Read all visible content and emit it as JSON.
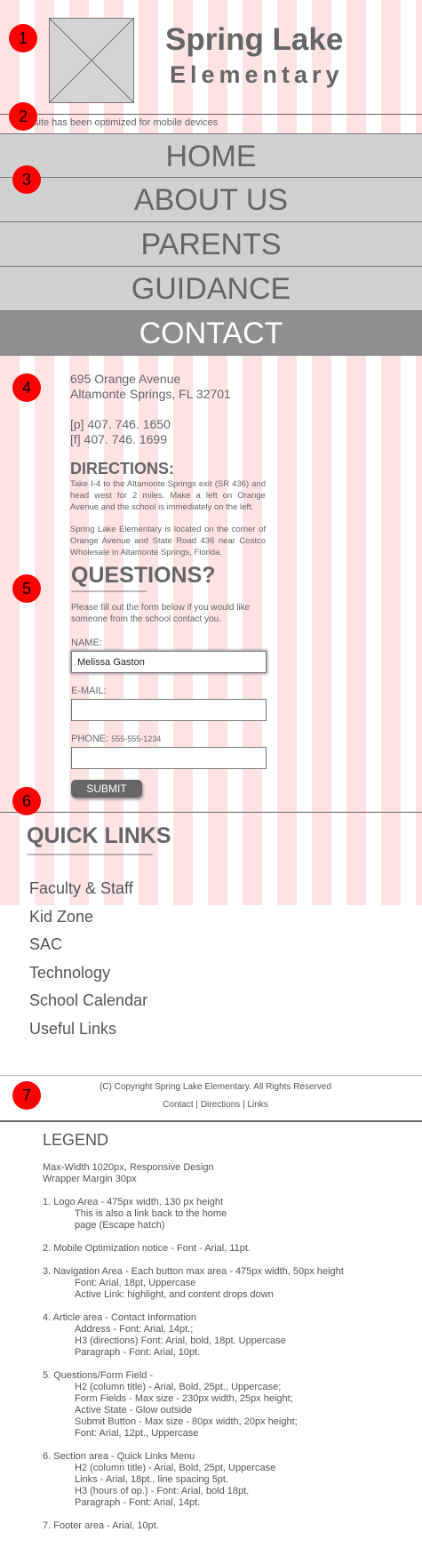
{
  "header": {
    "title_line1": "Spring Lake",
    "title_line2": "Elementary",
    "mobile_notice": "site has been optimized for mobile devices"
  },
  "markers": [
    "1",
    "2",
    "3",
    "4",
    "5",
    "6",
    "7"
  ],
  "nav": {
    "items": [
      {
        "label": "HOME",
        "active": false
      },
      {
        "label": "ABOUT US",
        "active": false
      },
      {
        "label": "PARENTS",
        "active": false
      },
      {
        "label": "GUIDANCE",
        "active": false
      },
      {
        "label": "CONTACT",
        "active": true
      }
    ]
  },
  "article": {
    "address_line1": "695 Orange Avenue",
    "address_line2": "Altamonte Springs, FL 32701",
    "phone": "[p] 407. 746. 1650",
    "fax": "[f] 407. 746. 1699",
    "directions_title": "DIRECTIONS:",
    "directions_text": "Take I-4 to the Altamonte Springs exit (SR 436) and head west for 2 miles. Make a left on Orange Avenue and the school is immediately on the left.",
    "location_text": "Spring Lake Elementary is located on the corner of Orange Avenue and State Road 436 near Costco Wholesale in Altamonte Springs, Florida."
  },
  "questions": {
    "title": "QUESTIONS?",
    "rule": "--------------------------------",
    "intro": "Please fill out the form below if you would like someone from the school contact you.",
    "name_label": "NAME:",
    "name_value": "Melissa Gaston",
    "email_label": "E-MAIL:",
    "email_value": "",
    "phone_label": "PHONE:",
    "phone_hint": "555-555-1234",
    "phone_value": "",
    "submit_label": "SUBMIT"
  },
  "quick_links": {
    "title": "QUICK LINKS",
    "rule": "-----------------------------------------------------",
    "links": [
      "Faculty & Staff",
      "Kid Zone",
      "SAC",
      "Technology",
      "School Calendar",
      "Useful Links"
    ]
  },
  "footer": {
    "copyright": "(C) Copyright Spring Lake Elementary. All Rights Reserved",
    "links": [
      "Contact",
      "Directions",
      "Links"
    ],
    "separator": "|"
  },
  "legend": {
    "title": "LEGEND",
    "lines": [
      {
        "text": "Max-Width 1020px, Responsive Design",
        "indent": false
      },
      {
        "text": "Wrapper Margin 30px",
        "indent": false
      },
      {
        "text": "",
        "indent": false
      },
      {
        "text": "1. Logo Area - 475px width, 130 px height",
        "indent": false
      },
      {
        "text": "This is also a link back to the home",
        "indent": true
      },
      {
        "text": "page (Escape hatch)",
        "indent": true
      },
      {
        "text": "",
        "indent": false
      },
      {
        "text": "2. Mobile Optimization notice - Font - Arial, 11pt.",
        "indent": false
      },
      {
        "text": "",
        "indent": false
      },
      {
        "text": "3. Navigation Area - Each button max area - 475px width, 50px height",
        "indent": false
      },
      {
        "text": "Font: Arial, 18pt, Uppercase",
        "indent": true
      },
      {
        "text": "Active Link: highlight, and content drops down",
        "indent": true
      },
      {
        "text": "",
        "indent": false
      },
      {
        "text": "4. Article area - Contact Information",
        "indent": false
      },
      {
        "text": "Address - Font: Arial, 14pt.;",
        "indent": true
      },
      {
        "text": "H3 (directions) Font: Arial, bold, 18pt. Uppercase",
        "indent": true
      },
      {
        "text": "Paragraph - Font: Arial, 10pt.",
        "indent": true
      },
      {
        "text": "",
        "indent": false
      },
      {
        "text": "5. Questions/Form Field -",
        "indent": false
      },
      {
        "text": "H2 (column title) - Arial, Bold, 25pt., Uppercase;",
        "indent": true
      },
      {
        "text": "Form Fields - Max size - 230px width, 25px height;",
        "indent": true
      },
      {
        "text": "Active State - Glow outside",
        "indent": true
      },
      {
        "text": "Submit Button - Max size - 80px width, 20px height;",
        "indent": true
      },
      {
        "text": "Font: Arial, 12pt., Uppercase",
        "indent": true
      },
      {
        "text": "",
        "indent": false
      },
      {
        "text": "6. Section area - Quick Links Menu",
        "indent": false
      },
      {
        "text": "H2 (column title) - Arial, Bold, 25pt, Uppercase",
        "indent": true
      },
      {
        "text": "Links - Arial, 18pt., line spacing 5pt.",
        "indent": true
      },
      {
        "text": "H3 (hours of op.) - Font: Arial, bold 18pt.",
        "indent": true
      },
      {
        "text": "Paragraph - Font: Arial, 14pt.",
        "indent": true
      },
      {
        "text": "",
        "indent": false
      },
      {
        "text": "7. Footer area - Arial, 10pt.",
        "indent": false
      }
    ]
  }
}
